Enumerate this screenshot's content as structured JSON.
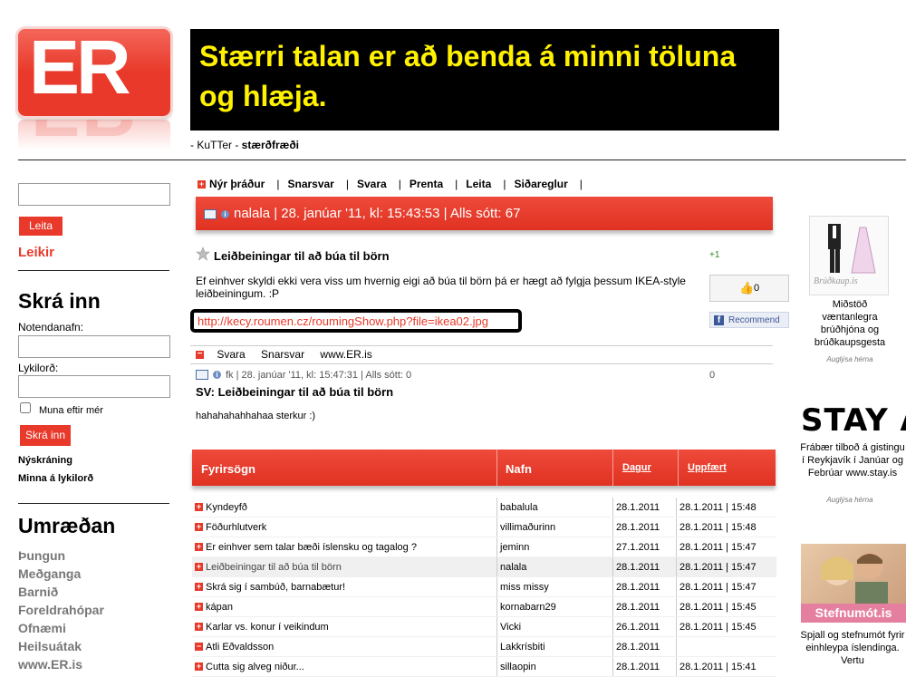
{
  "logo": {
    "text": "ER"
  },
  "quote": {
    "text": "Stærri talan er að benda á minni töluna og hlæja.",
    "author_prefix": "- KuTTer - ",
    "author_topic": "stærðfræði"
  },
  "sidebar": {
    "search_button": "Leita",
    "games_link": "Leikir",
    "login_heading": "Skrá inn",
    "username_label": "Notendanafn:",
    "password_label": "Lykilorð:",
    "remember_label": "Muna eftir mér",
    "login_button": "Skrá inn",
    "register_link": "Nýskráning",
    "forgot_link": "Minna á lykilorð",
    "discussion_heading": "Umræðan",
    "categories": [
      "Þungun",
      "Meðganga",
      "Barnið",
      "Foreldrahópar",
      "Ofnæmi",
      "Heilsuátak",
      "www.ER.is"
    ]
  },
  "toolbar": {
    "items": [
      "Nýr þráður",
      "Snarsvar",
      "Svara",
      "Prenta",
      "Leita",
      "Siðareglur"
    ]
  },
  "post": {
    "header": "nalala | 28. janúar '11, kl: 15:43:53 | Alls sótt: 67",
    "title": "Leiðbeiningar til að búa til börn",
    "plus_one": "+1",
    "body": "Ef einhver skyldi ekki vera viss um hvernig eigi að búa til börn þá er hægt að fylgja þessum IKEA-style leiðbeiningum. :P",
    "link": "http://kecy.roumen.cz/roumingShow.php?file=ikea02.jpg",
    "like_count": "0",
    "recommend_label": "Recommend",
    "actions": [
      "Svara",
      "Snarsvar",
      "www.ER.is"
    ]
  },
  "reply": {
    "meta": "fk | 28. janúar '11, kl: 15:47:31 | Alls sótt: 0",
    "count": "0",
    "title": "SV: Leiðbeiningar til að búa til börn",
    "body": "hahahahahhahaa sterkur :)"
  },
  "topics": {
    "headers": {
      "subject": "Fyrirsögn",
      "name": "Nafn",
      "date": "Dagur",
      "updated": "Uppfært"
    },
    "rows": [
      {
        "subject": "Kyndeyfð",
        "name": "babalula",
        "date": "28.1.2011",
        "updated": "28.1.2011 | 15:48"
      },
      {
        "subject": "Föðurhlutverk",
        "name": "villimaðurinn",
        "date": "28.1.2011",
        "updated": "28.1.2011 | 15:48"
      },
      {
        "subject": "Er einhver sem talar bæði íslensku og tagalog ?",
        "name": "jeminn",
        "date": "27.1.2011",
        "updated": "28.1.2011 | 15:47"
      },
      {
        "subject": "Leiðbeiningar til að búa til börn",
        "name": "nalala",
        "date": "28.1.2011",
        "updated": "28.1.2011 | 15:47"
      },
      {
        "subject": "Skrá sig í sambúð, barnabætur!",
        "name": "miss missy",
        "date": "28.1.2011",
        "updated": "28.1.2011 | 15:47"
      },
      {
        "subject": "kápan",
        "name": "kornabarn29",
        "date": "28.1.2011",
        "updated": "28.1.2011 | 15:45"
      },
      {
        "subject": "Karlar vs. konur í veikindum",
        "name": "Vicki",
        "date": "26.1.2011",
        "updated": "28.1.2011 | 15:45"
      },
      {
        "subject": "Atli Eðvaldsson",
        "name": "Lakkrísbiti",
        "date": "28.1.2011",
        "updated": ""
      },
      {
        "subject": "Cutta sig alveg niður...",
        "name": "sillaopin",
        "date": "28.1.2011",
        "updated": "28.1.2011 | 15:41"
      }
    ]
  },
  "ads": [
    {
      "image_text": "Brúðkaup.is",
      "text": "Miðstöð væntanlegra brúðhjóna og brúðkaupsgesta",
      "sub": "Auglýsa hérna"
    },
    {
      "image_text": "STAY AP",
      "text": "Frábær tilboð á gistingu í Reykjavík í Janúar og Febrúar www.stay.is",
      "sub": "Auglýsa hérna"
    },
    {
      "image_text": "Stefnumót.is",
      "text": "Spjall og stefnumót fyrir einhleypa íslendinga. Vertu",
      "sub": ""
    }
  ],
  "colors": {
    "accent": "#e8392a",
    "quote_bg": "#000000",
    "quote_text": "#fff100"
  }
}
